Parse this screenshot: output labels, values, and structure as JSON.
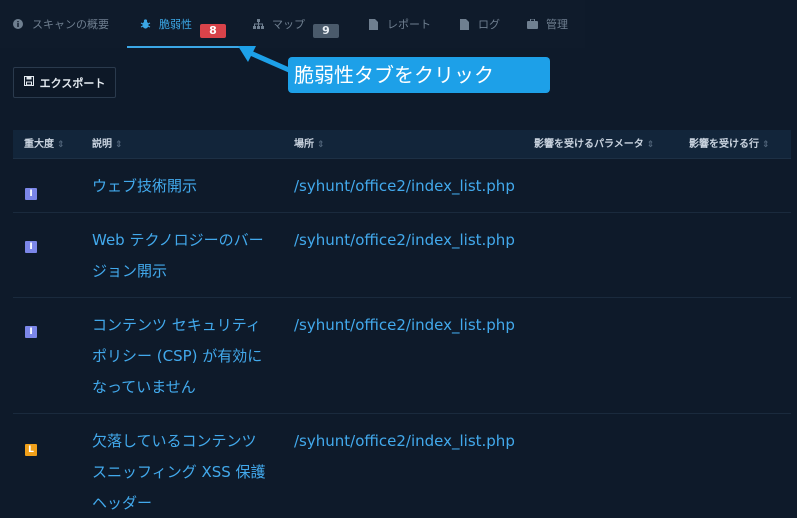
{
  "tabs": [
    {
      "label": "スキャンの概要",
      "icon": "info-circle-icon"
    },
    {
      "label": "脆弱性",
      "icon": "bug-icon",
      "badge": "8",
      "active": true
    },
    {
      "label": "マップ",
      "icon": "sitemap-icon",
      "badge": "9"
    },
    {
      "label": "レポート",
      "icon": "file-icon"
    },
    {
      "label": "ログ",
      "icon": "file-icon"
    },
    {
      "label": "管理",
      "icon": "briefcase-icon"
    }
  ],
  "callout": {
    "text": "脆弱性タブをクリック"
  },
  "toolbar": {
    "export_label": "エクスポート"
  },
  "table": {
    "columns": [
      "重大度",
      "説明",
      "場所",
      "影響を受けるパラメータ",
      "影響を受ける行"
    ],
    "rows": [
      {
        "severity": "I",
        "severity_level": "info",
        "description_lines": [
          "ウェブ技術開示"
        ],
        "location": "/syhunt/office2/index_list.php"
      },
      {
        "severity": "I",
        "severity_level": "info",
        "description_lines": [
          "Web テクノロジーのバー",
          "ジョン開示"
        ],
        "location": "/syhunt/office2/index_list.php"
      },
      {
        "severity": "I",
        "severity_level": "info",
        "description_lines": [
          "コンテンツ セキュリティ",
          "ポリシー (CSP) が有効に",
          "なっていません"
        ],
        "location": "/syhunt/office2/index_list.php"
      },
      {
        "severity": "L",
        "severity_level": "low",
        "description_lines": [
          "欠落しているコンテンツ",
          "スニッフィング XSS 保護",
          "ヘッダー"
        ],
        "location": "/syhunt/office2/index_list.php"
      }
    ]
  },
  "colors": {
    "accent": "#3ba7e6",
    "callout": "#1da0e8",
    "badge_red": "#d9434a",
    "severity_info": "#7b86e8",
    "severity_low": "#f0a01a"
  }
}
